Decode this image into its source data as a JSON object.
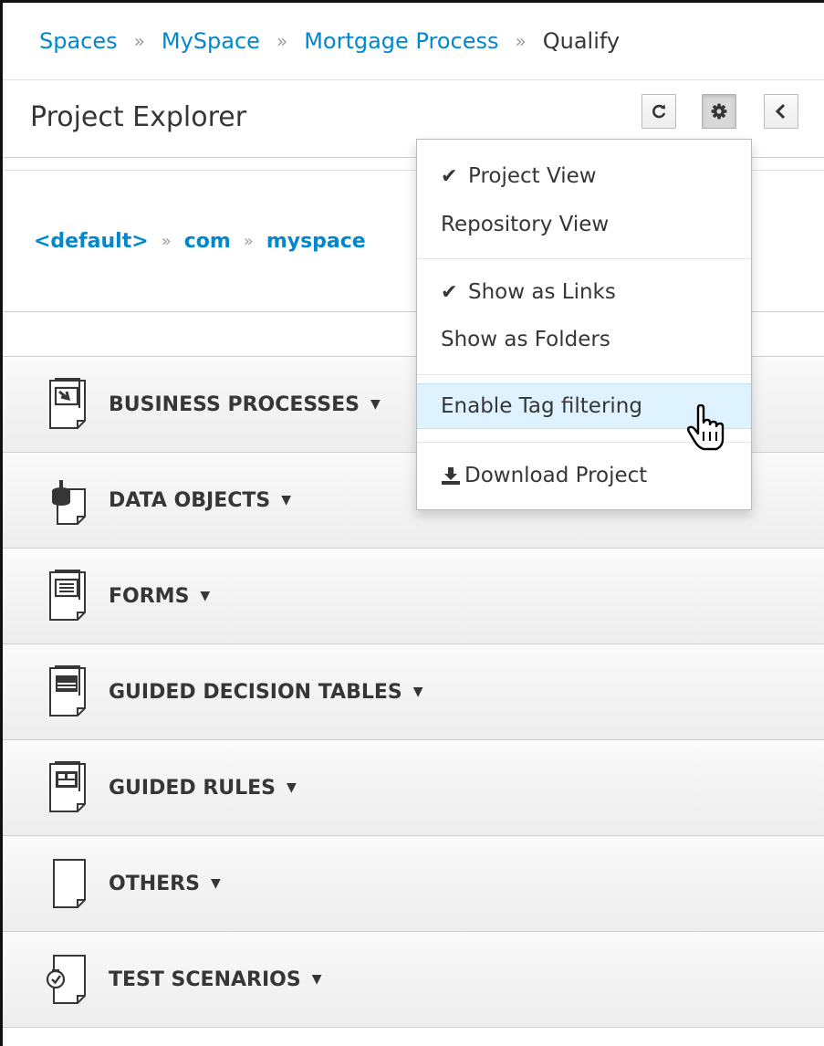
{
  "breadcrumb": {
    "items": [
      "Spaces",
      "MySpace",
      "Mortgage Process"
    ],
    "current": "Qualify",
    "separator": "»"
  },
  "header": {
    "title": "Project Explorer",
    "buttons": {
      "refresh": "refresh-icon",
      "settings": "gear-icon",
      "collapse": "chevron-left-icon"
    }
  },
  "package": {
    "items": [
      "<default>",
      "com",
      "myspace"
    ],
    "separator": "»"
  },
  "sections": [
    {
      "label": "BUSINESS PROCESSES",
      "icon": "business-process-icon"
    },
    {
      "label": "DATA OBJECTS",
      "icon": "data-object-icon"
    },
    {
      "label": "FORMS",
      "icon": "form-icon"
    },
    {
      "label": "GUIDED DECISION TABLES",
      "icon": "decision-table-icon"
    },
    {
      "label": "GUIDED RULES",
      "icon": "guided-rule-icon"
    },
    {
      "label": "OTHERS",
      "icon": "document-icon"
    },
    {
      "label": "TEST SCENARIOS",
      "icon": "test-scenario-icon"
    }
  ],
  "menu": {
    "project_view": "Project View",
    "repository_view": "Repository View",
    "show_as_links": "Show as Links",
    "show_as_folders": "Show as Folders",
    "enable_tag_filtering": "Enable Tag filtering",
    "download_project": "Download Project",
    "check_glyph": "✔"
  },
  "colors": {
    "link": "#0088ce",
    "highlight": "#def3ff",
    "text": "#363636"
  }
}
